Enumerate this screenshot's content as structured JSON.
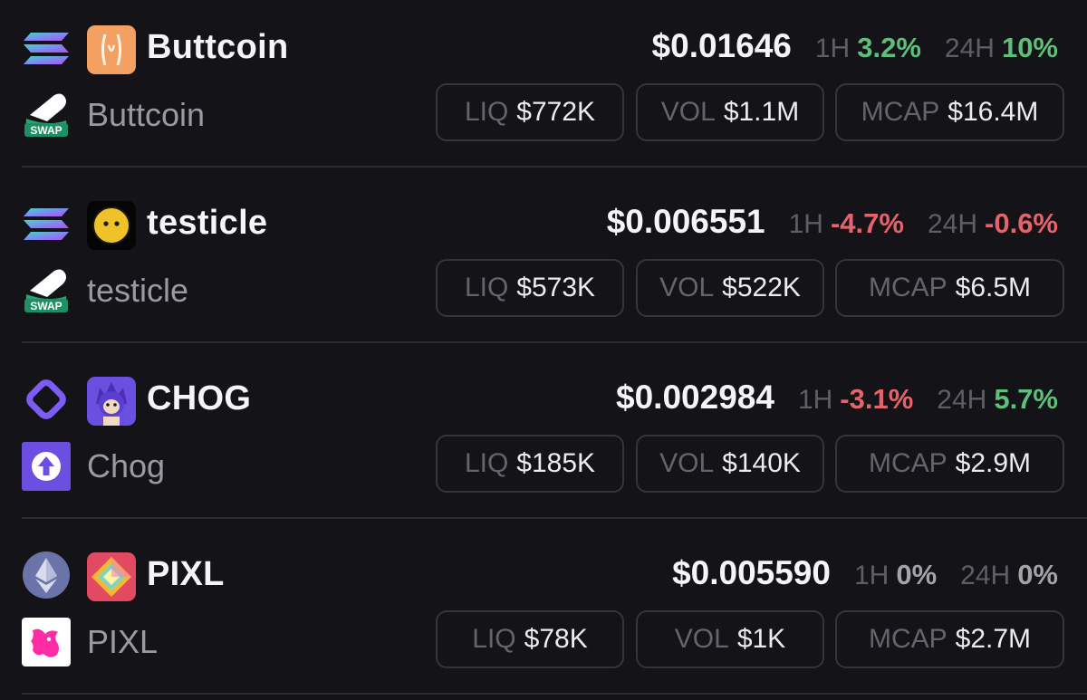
{
  "tokens": [
    {
      "chain": "solana-icon",
      "logo": "buttcoin-logo-icon",
      "dex": "swap-pill-icon",
      "symbol": "Buttcoin",
      "name": "Buttcoin",
      "price": "$0.01646",
      "tf1_label": "1H",
      "tf1_change": "3.2%",
      "tf1_trend": "up",
      "tf2_label": "24H",
      "tf2_change": "10%",
      "tf2_trend": "up",
      "liq_label": "LIQ",
      "liq": "$772K",
      "vol_label": "VOL",
      "vol": "$1.1M",
      "mcap_label": "MCAP",
      "mcap": "$16.4M"
    },
    {
      "chain": "solana-icon",
      "logo": "testicle-logo-icon",
      "dex": "swap-pill-icon",
      "symbol": "testicle",
      "name": "testicle",
      "price": "$0.006551",
      "tf1_label": "1H",
      "tf1_change": "-4.7%",
      "tf1_trend": "down",
      "tf2_label": "24H",
      "tf2_change": "-0.6%",
      "tf2_trend": "down",
      "liq_label": "LIQ",
      "liq": "$573K",
      "vol_label": "VOL",
      "vol": "$522K",
      "mcap_label": "MCAP",
      "mcap": "$6.5M"
    },
    {
      "chain": "monad-icon",
      "logo": "chog-logo-icon",
      "dex": "upload-arrow-icon",
      "symbol": "CHOG",
      "name": "Chog",
      "price": "$0.002984",
      "tf1_label": "1H",
      "tf1_change": "-3.1%",
      "tf1_trend": "down",
      "tf2_label": "24H",
      "tf2_change": "5.7%",
      "tf2_trend": "up",
      "liq_label": "LIQ",
      "liq": "$185K",
      "vol_label": "VOL",
      "vol": "$140K",
      "mcap_label": "MCAP",
      "mcap": "$2.9M"
    },
    {
      "chain": "ethereum-icon",
      "logo": "pixl-logo-icon",
      "dex": "uniswap-unicorn-icon",
      "symbol": "PIXL",
      "name": "PIXL",
      "price": "$0.005590",
      "tf1_label": "1H",
      "tf1_change": "0%",
      "tf1_trend": "flat",
      "tf2_label": "24H",
      "tf2_change": "0%",
      "tf2_trend": "flat",
      "liq_label": "LIQ",
      "liq": "$78K",
      "vol_label": "VOL",
      "vol": "$1K",
      "mcap_label": "MCAP",
      "mcap": "$2.7M"
    }
  ],
  "swap_badge_text": "SWAP",
  "colors": {
    "background": "#141418",
    "positive": "#5fbf7a",
    "negative": "#e5636a",
    "neutral": "#a3a3aa",
    "pill_border": "#34343b"
  }
}
